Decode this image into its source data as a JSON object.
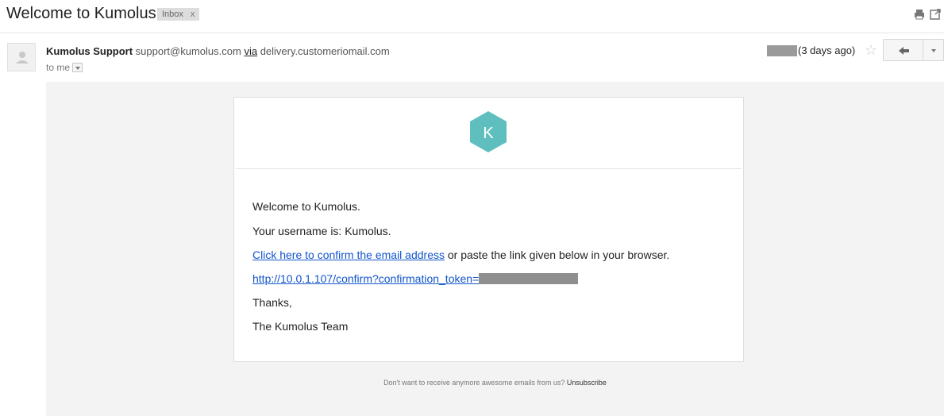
{
  "header": {
    "subject": "Welcome to Kumolus",
    "label_chip": "Inbox",
    "label_remove": "x",
    "icons": {
      "print": "print-icon",
      "new_window": "new-window-icon"
    }
  },
  "message": {
    "sender_name": "Kumolus Support",
    "sender_email": "support@kumolus.com",
    "via_label": "via",
    "via_domain": "delivery.customeriomail.com",
    "to_line": "to me",
    "date_relative": "(3 days ago)",
    "icons": {
      "avatar": "avatar-icon",
      "star": "star-icon",
      "reply": "reply-icon",
      "more": "chevron-down-icon"
    }
  },
  "email": {
    "logo_letter": "K",
    "brand_color": "#5fbfbf",
    "greeting": "Welcome to Kumolus.",
    "username_line": "Your username is: Kumolus.",
    "confirm_link_text": "Click here to confirm the email address",
    "confirm_suffix": " or paste the link given below in your browser.",
    "confirm_url": "http://10.0.1.107/confirm?confirmation_token=",
    "thanks": "Thanks,",
    "signature": "The Kumolus Team"
  },
  "footer": {
    "text": "Don't want to receive anymore awesome emails from us? ",
    "unsubscribe": "Unsubscribe"
  }
}
